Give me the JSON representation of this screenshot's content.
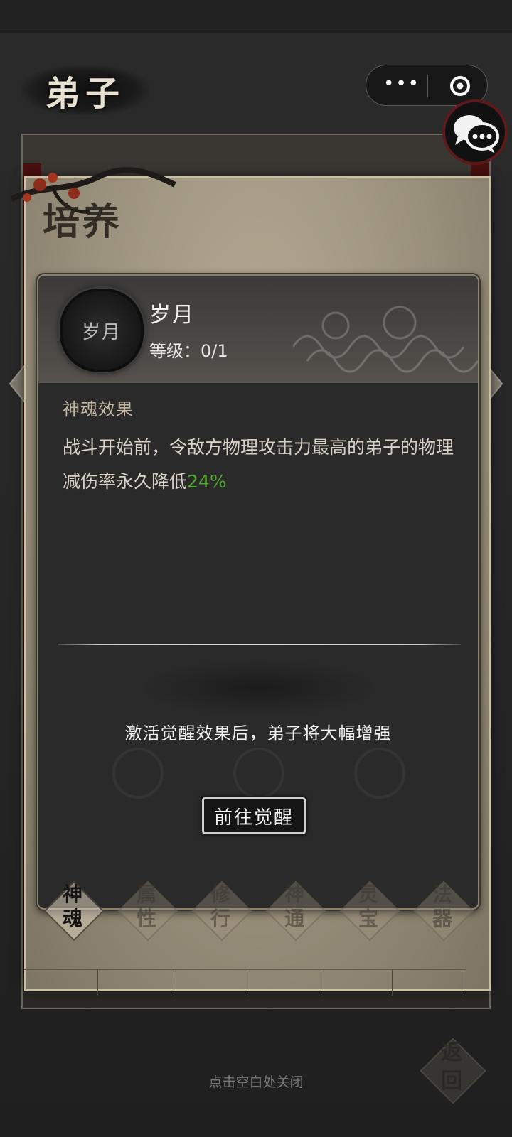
{
  "screen": {
    "title": "弟子",
    "close_hint": "点击空白处关闭",
    "back_button": "返回"
  },
  "miniprogram_capsule": {
    "more_icon": "more-dots-icon",
    "close_icon": "target-close-icon"
  },
  "chat_button": {
    "icon": "chat-bubbles-icon"
  },
  "panel": {
    "title": "培养",
    "soul": {
      "badge_text": "岁月",
      "name": "岁月",
      "level": "等级：0/1"
    },
    "effect": {
      "label": "神魂效果",
      "text": "战斗开始前，令敌方物理攻击力最高的弟子的物理减伤率永久降低",
      "value": "24%"
    },
    "awaken": {
      "hint": "激活觉醒效果后，弟子将大幅增强",
      "button": "前往觉醒"
    },
    "tabs": [
      {
        "label": "神魂",
        "active": true
      },
      {
        "label": "属性",
        "active": false
      },
      {
        "label": "修行",
        "active": false
      },
      {
        "label": "神通",
        "active": false
      },
      {
        "label": "灵宝",
        "active": false
      },
      {
        "label": "法器",
        "active": false
      }
    ]
  },
  "colors": {
    "highlight_green": "#4fa82f",
    "card_bg": "#2a2a2a",
    "parchment": "#9a917c",
    "accent_red": "#5e1a1a"
  }
}
